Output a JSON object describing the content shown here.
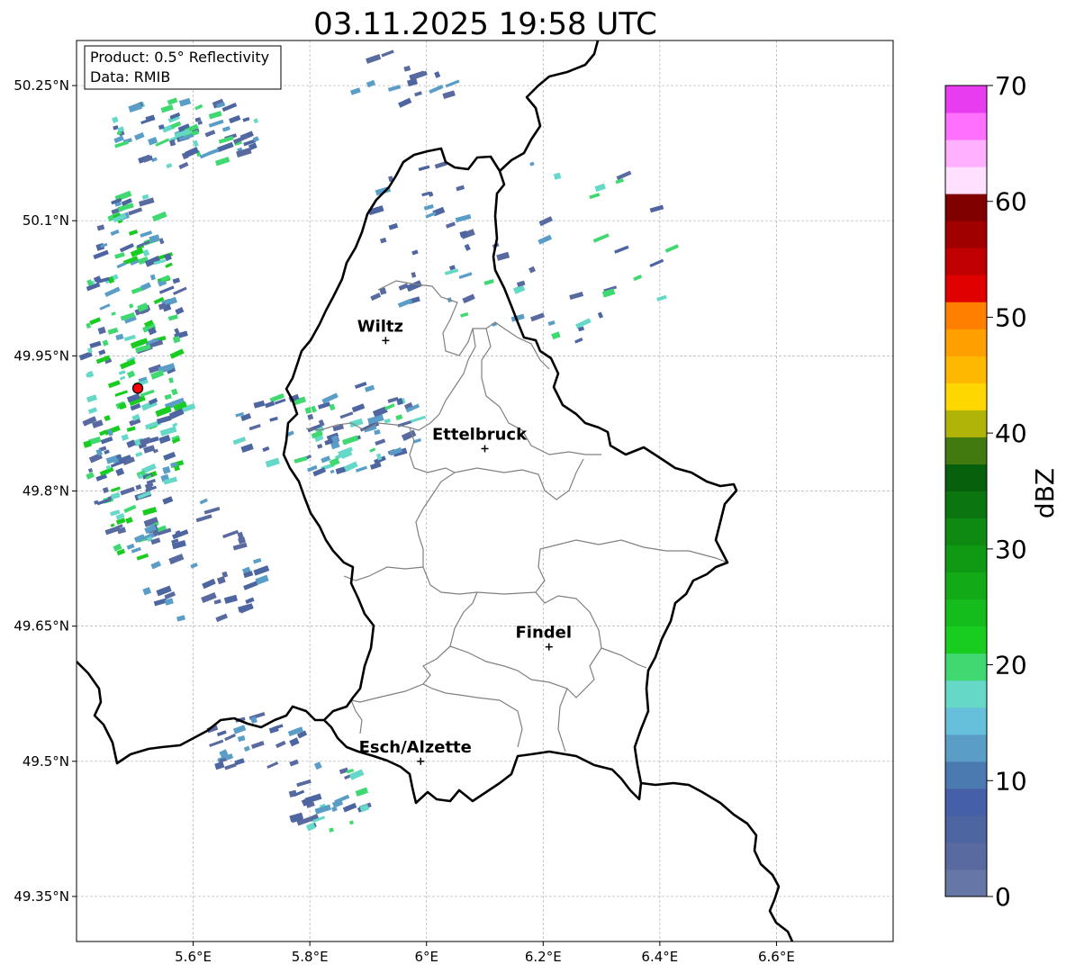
{
  "title": "03.11.2025 19:58 UTC",
  "info_box": {
    "product": "Product: 0.5° Reflectivity",
    "data_source": "Data: RMIB"
  },
  "map_extent": {
    "lon_min": 5.4,
    "lon_max": 6.8,
    "lat_min": 49.3,
    "lat_max": 50.3
  },
  "lon_ticks": [
    {
      "value": 5.6,
      "label": "5.6°E"
    },
    {
      "value": 5.8,
      "label": "5.8°E"
    },
    {
      "value": 6.0,
      "label": "6°E"
    },
    {
      "value": 6.2,
      "label": "6.2°E"
    },
    {
      "value": 6.4,
      "label": "6.4°E"
    },
    {
      "value": 6.6,
      "label": "6.6°E"
    }
  ],
  "lat_ticks": [
    {
      "value": 50.25,
      "label": "50.25°N"
    },
    {
      "value": 50.1,
      "label": "50.1°N"
    },
    {
      "value": 49.95,
      "label": "49.95°N"
    },
    {
      "value": 49.8,
      "label": "49.8°N"
    },
    {
      "value": 49.65,
      "label": "49.65°N"
    },
    {
      "value": 49.5,
      "label": "49.5°N"
    },
    {
      "value": 49.35,
      "label": "49.35°N"
    }
  ],
  "cities": [
    {
      "name": "Wiltz",
      "lon": 5.93,
      "lat": 49.967
    },
    {
      "name": "Ettelbruck",
      "lon": 6.1,
      "lat": 49.847
    },
    {
      "name": "Findel",
      "lon": 6.21,
      "lat": 49.627
    },
    {
      "name": "Esch/Alzette",
      "lon": 5.99,
      "lat": 49.5
    }
  ],
  "radar_site": {
    "lon": 5.505,
    "lat": 49.914,
    "color": "#ff0000"
  },
  "colorbar": {
    "label": "dBZ",
    "min": 0,
    "max": 70,
    "ticks": [
      {
        "value": 0,
        "label": "0"
      },
      {
        "value": 10,
        "label": "10"
      },
      {
        "value": 20,
        "label": "20"
      },
      {
        "value": 30,
        "label": "30"
      },
      {
        "value": 40,
        "label": "40"
      },
      {
        "value": 50,
        "label": "50"
      },
      {
        "value": 60,
        "label": "60"
      },
      {
        "value": 70,
        "label": "70"
      }
    ],
    "colors": [
      "#6676a6",
      "#586aa0",
      "#4d65a0",
      "#4560a6",
      "#4a7ab0",
      "#5a9ec8",
      "#66c0dc",
      "#66d8c8",
      "#40d870",
      "#18cc20",
      "#14bc1c",
      "#12aa16",
      "#109a14",
      "#0e8a12",
      "#0b760f",
      "#06600c",
      "#427a10",
      "#afb406",
      "#ffd700",
      "#ffb800",
      "#ff9f00",
      "#ff8000",
      "#e00000",
      "#c00000",
      "#a00000",
      "#800000",
      "#ffe0ff",
      "#ffb0ff",
      "#ff70ff",
      "#e83cf0"
    ]
  },
  "echo_colors": [
    "#4d65a0",
    "#586aa0",
    "#5a9ec8",
    "#66d8c8",
    "#40d870",
    "#18cc20"
  ],
  "echo_regions": [
    {
      "lon": 5.49,
      "lat": 49.93,
      "lon_spread": 0.09,
      "lat_spread": 0.21,
      "count": 240,
      "intensity": "high"
    },
    {
      "lon": 5.58,
      "lat": 50.2,
      "lon_spread": 0.13,
      "lat_spread": 0.04,
      "count": 70,
      "intensity": "medium"
    },
    {
      "lon": 5.83,
      "lat": 49.87,
      "lon_spread": 0.17,
      "lat_spread": 0.05,
      "count": 80,
      "intensity": "medium"
    },
    {
      "lon": 5.6,
      "lat": 49.72,
      "lon_spread": 0.12,
      "lat_spread": 0.07,
      "count": 40,
      "intensity": "low"
    },
    {
      "lon": 5.82,
      "lat": 49.46,
      "lon_spread": 0.07,
      "lat_spread": 0.04,
      "count": 30,
      "intensity": "medium"
    },
    {
      "lon": 5.7,
      "lat": 49.52,
      "lon_spread": 0.1,
      "lat_spread": 0.03,
      "count": 25,
      "intensity": "low"
    },
    {
      "lon": 6.22,
      "lat": 50.05,
      "lon_spread": 0.2,
      "lat_spread": 0.12,
      "count": 40,
      "intensity": "medium"
    },
    {
      "lon": 5.98,
      "lat": 50.07,
      "lon_spread": 0.1,
      "lat_spread": 0.1,
      "count": 25,
      "intensity": "low"
    },
    {
      "lon": 5.95,
      "lat": 50.25,
      "lon_spread": 0.1,
      "lat_spread": 0.04,
      "count": 15,
      "intensity": "low"
    }
  ]
}
